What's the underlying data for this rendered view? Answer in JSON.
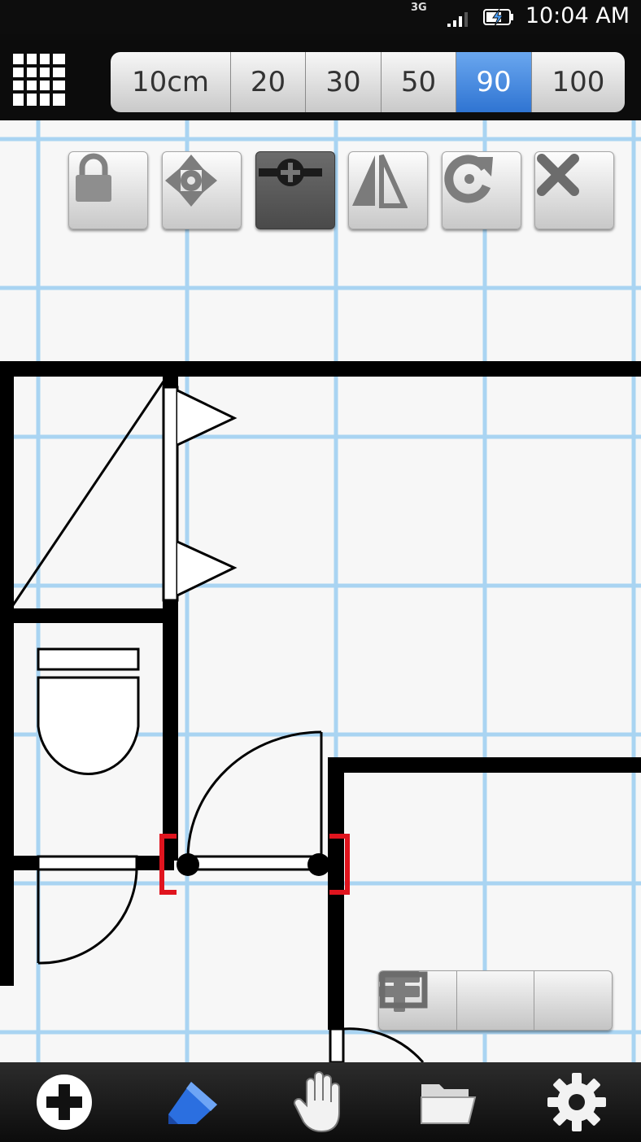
{
  "status_bar": {
    "network": "3G",
    "time": "10:04 AM"
  },
  "scale_selector": {
    "options": [
      "10cm",
      "20",
      "30",
      "50",
      "90",
      "100"
    ],
    "selected": "90",
    "accent": "#3f82dc"
  },
  "edit_tools": [
    {
      "name": "lock-icon"
    },
    {
      "name": "move-icon"
    },
    {
      "name": "resize-icon",
      "active": true
    },
    {
      "name": "mirror-icon"
    },
    {
      "name": "rotate-icon"
    },
    {
      "name": "delete-icon"
    }
  ],
  "zoom_controls": [
    {
      "name": "zoom-out-icon"
    },
    {
      "name": "zoom-in-icon"
    },
    {
      "name": "fit-screen-icon"
    }
  ],
  "bottom_bar": [
    {
      "name": "add-icon"
    },
    {
      "name": "draw-icon",
      "active": true
    },
    {
      "name": "pan-icon"
    },
    {
      "name": "open-folder-icon"
    },
    {
      "name": "settings-icon"
    }
  ],
  "colors": {
    "grid_line": "#a9d4f2",
    "wall": "#000000",
    "selection": "#e0141e",
    "selected_tool": "#555555"
  }
}
